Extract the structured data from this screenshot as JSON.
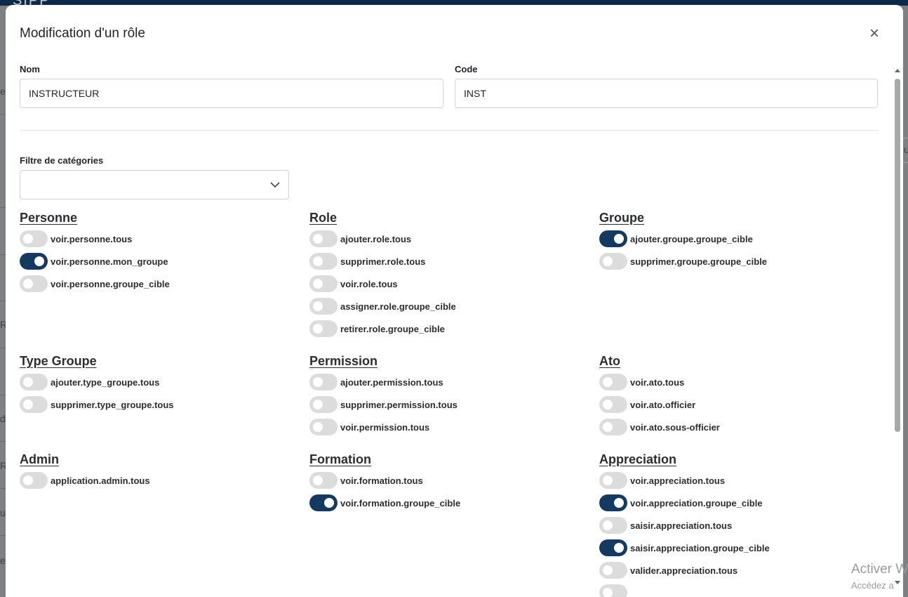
{
  "modal": {
    "title": "Modification d'un rôle",
    "close_symbol": "×",
    "nom": {
      "label": "Nom",
      "value": "INSTRUCTEUR"
    },
    "code": {
      "label": "Code",
      "value": "INST"
    },
    "filter": {
      "label": "Filtre de catégories",
      "value": ""
    }
  },
  "categories": {
    "personne": {
      "title": "Personne",
      "perms": [
        {
          "label": "voir.personne.tous",
          "on": false
        },
        {
          "label": "voir.personne.mon_groupe",
          "on": true
        },
        {
          "label": "voir.personne.groupe_cible",
          "on": false
        }
      ]
    },
    "role": {
      "title": "Role",
      "perms": [
        {
          "label": "ajouter.role.tous",
          "on": false
        },
        {
          "label": "supprimer.role.tous",
          "on": false
        },
        {
          "label": "voir.role.tous",
          "on": false
        },
        {
          "label": "assigner.role.groupe_cible",
          "on": false
        },
        {
          "label": "retirer.role.groupe_cible",
          "on": false
        }
      ]
    },
    "groupe": {
      "title": "Groupe",
      "perms": [
        {
          "label": "ajouter.groupe.groupe_cible",
          "on": true
        },
        {
          "label": "supprimer.groupe.groupe_cible",
          "on": false
        }
      ]
    },
    "type_groupe": {
      "title": "Type Groupe",
      "perms": [
        {
          "label": "ajouter.type_groupe.tous",
          "on": false
        },
        {
          "label": "supprimer.type_groupe.tous",
          "on": false
        }
      ]
    },
    "permission": {
      "title": "Permission",
      "perms": [
        {
          "label": "ajouter.permission.tous",
          "on": false
        },
        {
          "label": "supprimer.permission.tous",
          "on": false
        },
        {
          "label": "voir.permission.tous",
          "on": false
        }
      ]
    },
    "ato": {
      "title": "Ato",
      "perms": [
        {
          "label": "voir.ato.tous",
          "on": false
        },
        {
          "label": "voir.ato.officier",
          "on": false
        },
        {
          "label": "voir.ato.sous-officier",
          "on": false
        }
      ]
    },
    "admin": {
      "title": "Admin",
      "perms": [
        {
          "label": "application.admin.tous",
          "on": false
        }
      ]
    },
    "formation": {
      "title": "Formation",
      "perms": [
        {
          "label": "voir.formation.tous",
          "on": false
        },
        {
          "label": "voir.formation.groupe_cible",
          "on": true
        }
      ]
    },
    "appreciation": {
      "title": "Appreciation",
      "perms": [
        {
          "label": "voir.appreciation.tous",
          "on": false
        },
        {
          "label": "voir.appreciation.groupe_cible",
          "on": true
        },
        {
          "label": "saisir.appreciation.tous",
          "on": false
        },
        {
          "label": "saisir.appreciation.groupe_cible",
          "on": true
        },
        {
          "label": "valider.appreciation.tous",
          "on": false
        },
        {
          "label": "",
          "on": false
        }
      ]
    }
  },
  "backdrop": {
    "logo": "SIPP",
    "fragments": [
      "e",
      "u",
      "R",
      "d",
      "R",
      "u",
      "e"
    ]
  },
  "watermark": {
    "line1": "Activer W",
    "line2": "Accédez a"
  },
  "colors": {
    "toggle_on": "#153a62",
    "toggle_off": "#dcdcdc",
    "header_bar": "#0d2a4a"
  }
}
